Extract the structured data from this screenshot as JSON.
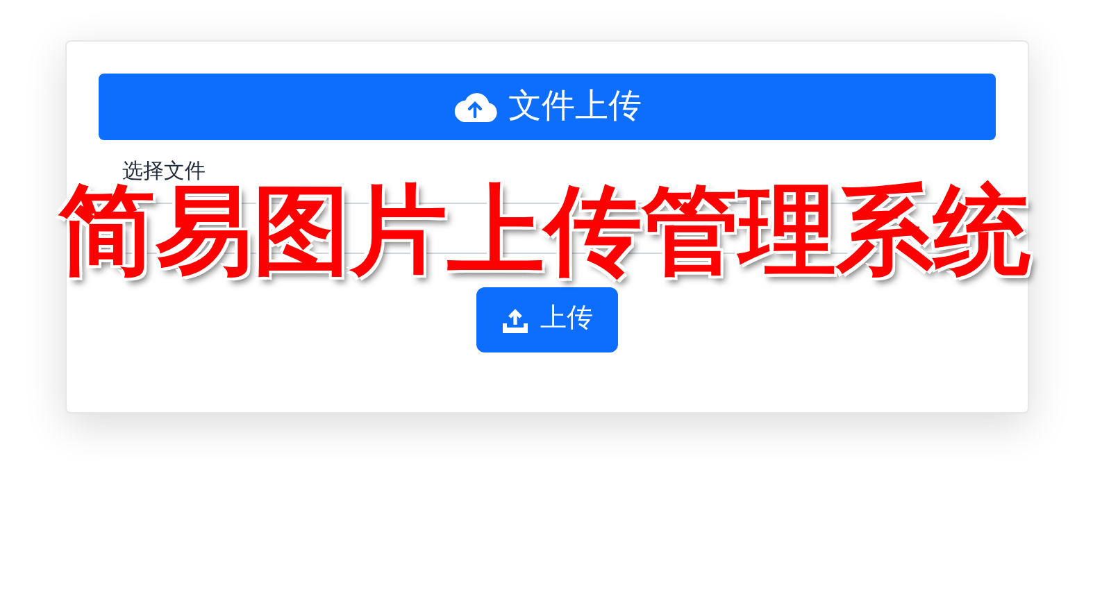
{
  "header": {
    "title": "文件上传"
  },
  "form": {
    "label": "选择文件"
  },
  "upload_button": {
    "label": "上传"
  },
  "overlay_title": "简易图片上传管理系统"
}
